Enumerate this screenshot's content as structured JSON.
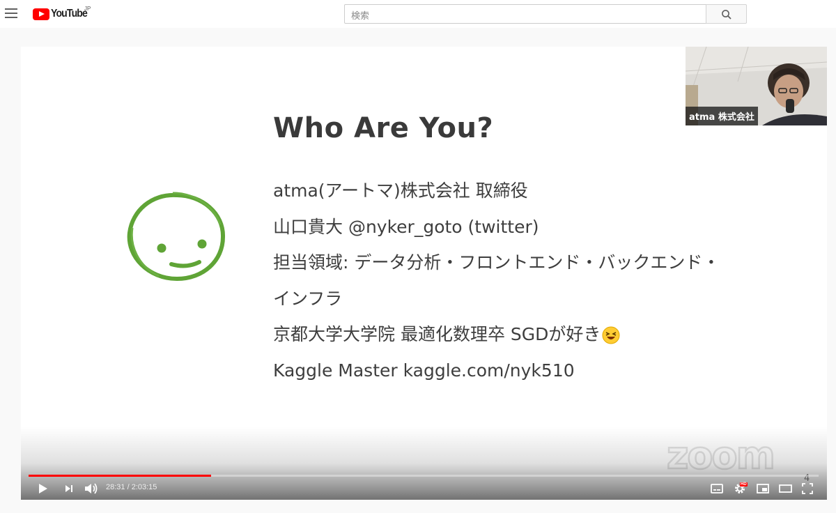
{
  "header": {
    "logo_text": "YouTube",
    "logo_region": "JP",
    "search_placeholder": "検索"
  },
  "video": {
    "slide": {
      "title": "Who Are You?",
      "lines": [
        "atma(アートマ)株式会社 取締役",
        "山口貴大 @nyker_goto (twitter)",
        "担当領域: データ分析・フロントエンド・バックエンド・",
        "インフラ",
        "京都大学大学院 最適化数理卒 SGDが好き",
        "Kaggle Master kaggle.com/nyk510"
      ],
      "face_color": "#5fa436",
      "watermark": "zoom",
      "page_number": "4"
    },
    "pip_label": "atma 株式会社"
  },
  "player": {
    "time_display": "28:31 / 2:03:15",
    "progress_fraction": 0.2306,
    "hd_badge": "HD",
    "accent_color": "#ff0000"
  }
}
